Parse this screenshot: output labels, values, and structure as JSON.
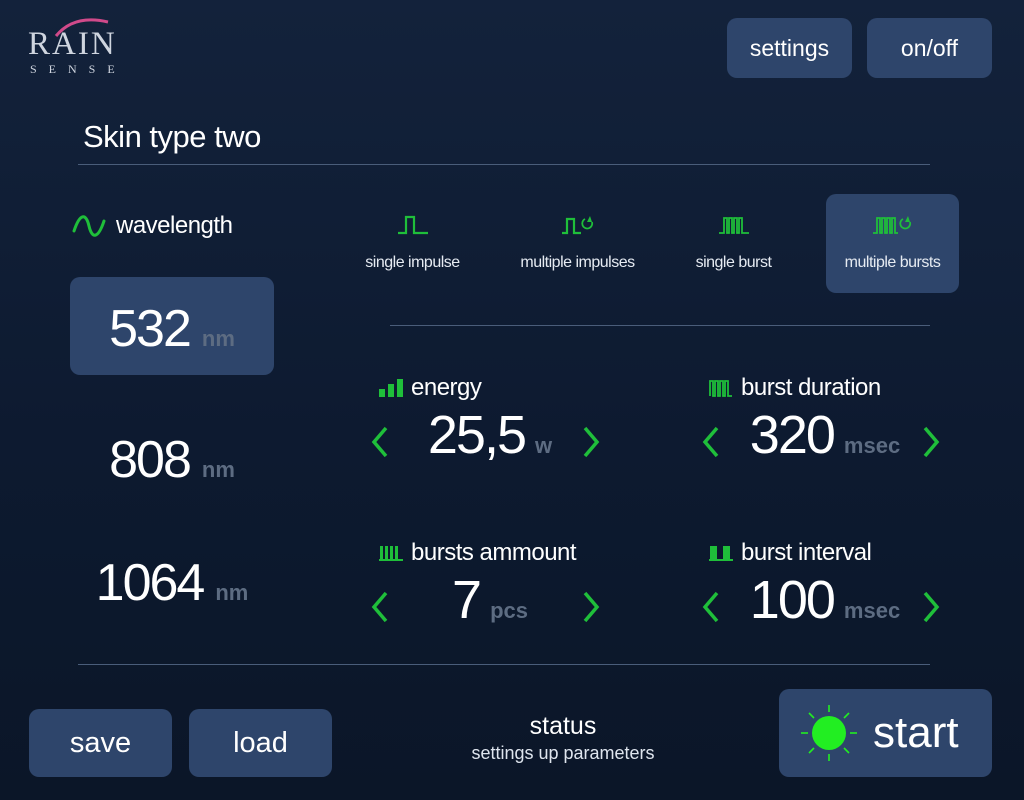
{
  "brand": {
    "logo_main": "RAIN",
    "logo_sub": "SENSE"
  },
  "header": {
    "settings_label": "settings",
    "power_label": "on/off"
  },
  "profile": {
    "title": "Skin type two"
  },
  "wavelength": {
    "label": "wavelength",
    "icon": "sine-wave-icon",
    "options": [
      {
        "value": "532",
        "unit": "nm",
        "selected": true
      },
      {
        "value": "808",
        "unit": "nm",
        "selected": false
      },
      {
        "value": "1064",
        "unit": "nm",
        "selected": false
      }
    ]
  },
  "modes": [
    {
      "label": "single impulse",
      "icon": "single-impulse-icon",
      "selected": false
    },
    {
      "label": "multiple impulses",
      "icon": "multiple-impulses-icon",
      "selected": false
    },
    {
      "label": "single burst",
      "icon": "single-burst-icon",
      "selected": false
    },
    {
      "label": "multiple bursts",
      "icon": "multiple-bursts-icon",
      "selected": true
    }
  ],
  "params": {
    "energy": {
      "label": "energy",
      "value": "25,5",
      "unit": "w",
      "icon": "energy-bars-icon"
    },
    "burst_duration": {
      "label": "burst duration",
      "value": "320",
      "unit": "msec",
      "icon": "burst-duration-icon"
    },
    "bursts_amount": {
      "label": "bursts ammount",
      "value": "7",
      "unit": "pcs",
      "icon": "bursts-amount-icon"
    },
    "burst_interval": {
      "label": "burst interval",
      "value": "100",
      "unit": "msec",
      "icon": "burst-interval-icon"
    }
  },
  "footer": {
    "save_label": "save",
    "load_label": "load",
    "status_title": "status",
    "status_text": "settings up parameters",
    "start_label": "start"
  },
  "colors": {
    "accent_green": "#1fbf3a",
    "panel": "#2e456b",
    "background": "#0f1d33",
    "indicator": "#22ee22"
  }
}
